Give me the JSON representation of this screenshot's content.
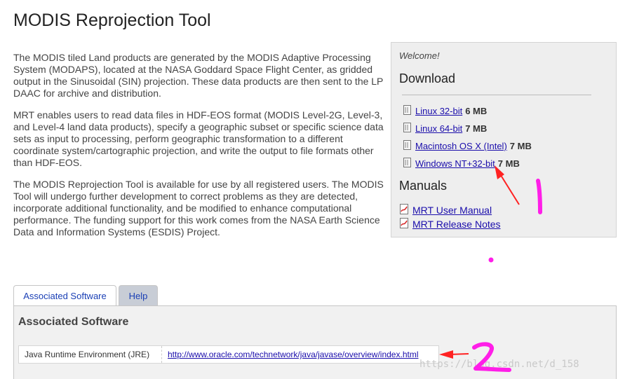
{
  "page": {
    "title": "MODIS Reprojection Tool"
  },
  "intro": {
    "paragraphs": [
      "The MODIS tiled Land products are generated by the MODIS Adaptive Processing System (MODAPS), located at the NASA Goddard Space Flight Center, as gridded output in the Sinusoidal (SIN) projection. These data products are then sent to the LP DAAC for archive and distribution.",
      "MRT enables users to read data files in HDF-EOS format (MODIS Level-2G, Level-3, and Level-4 land data products), specify a geographic subset or specific science data sets as input to processing, perform geographic transformation to a different coordinate system/cartographic projection, and write the output to file formats other than HDF-EOS.",
      "The MODIS Reprojection Tool is available for use by all registered users. The MODIS Tool will undergo further development to correct problems as they are detected, incorporate additional functionality, and be modified to enhance computational performance. The funding support for this work comes from the NASA Earth Science Data and Information Systems (ESDIS) Project."
    ]
  },
  "sidebar": {
    "welcome": "Welcome!",
    "download_heading": "Download",
    "downloads": [
      {
        "label": "Linux 32-bit",
        "size": "6 MB"
      },
      {
        "label": "Linux 64-bit",
        "size": "7 MB"
      },
      {
        "label": "Macintosh OS X (Intel)",
        "size": "7 MB"
      },
      {
        "label": "Windows NT+32-bit",
        "size": "7 MB"
      }
    ],
    "manuals_heading": "Manuals",
    "manuals": [
      {
        "label": "MRT User Manual"
      },
      {
        "label": "MRT Release Notes"
      }
    ]
  },
  "tabs": [
    {
      "label": "Associated Software"
    },
    {
      "label": "Help"
    }
  ],
  "panel": {
    "title": "Associated Software",
    "software": [
      {
        "name": "Java Runtime Environment (JRE)",
        "url": "http://www.oracle.com/technetwork/java/javase/overview/index.html"
      }
    ]
  },
  "annotations": {
    "color": "#ff1ee8",
    "arrow_color": "#ff2222",
    "label_1": "1",
    "label_2": "2"
  },
  "watermark": "https://blog.csdn.net/d_158"
}
